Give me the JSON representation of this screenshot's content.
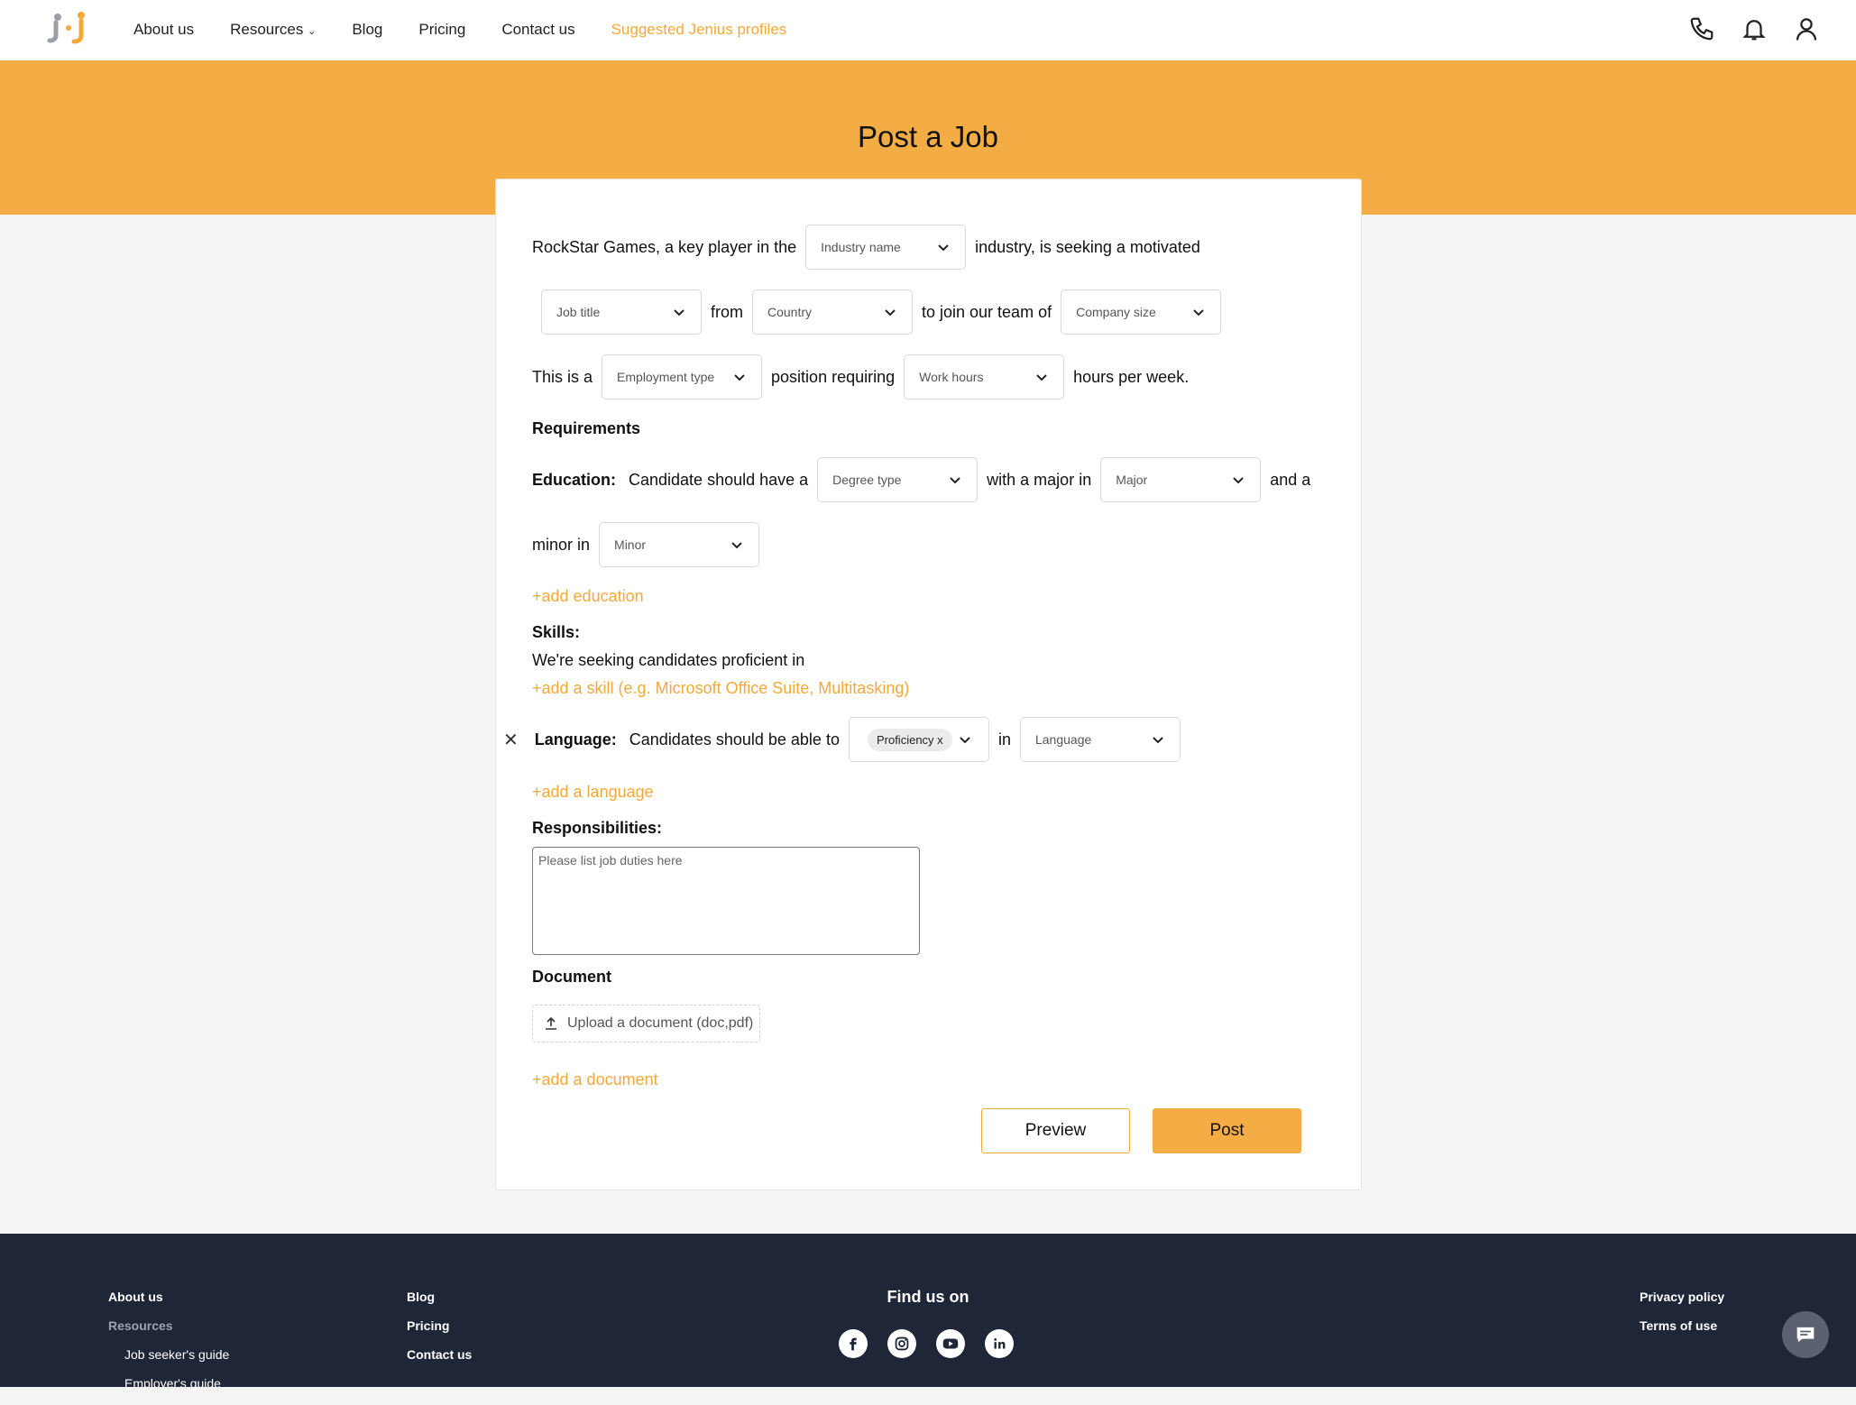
{
  "nav": {
    "links": [
      "About us",
      "Resources",
      "Blog",
      "Pricing",
      "Contact us",
      "Suggested Jenius profiles"
    ]
  },
  "page": {
    "title": "Post a Job"
  },
  "form": {
    "line1": {
      "prefix": "RockStar Games, a key player in the",
      "industry_placeholder": "Industry name",
      "suffix": "industry, is seeking a motivated"
    },
    "line2": {
      "job_placeholder": "Job title",
      "from": "from",
      "country_placeholder": "Country",
      "join": "to join our team of",
      "company_placeholder": "Company size"
    },
    "line3": {
      "prefix": "This is a",
      "employment_placeholder": "Employment type",
      "mid": "position requiring",
      "hours_placeholder": "Work hours",
      "suffix": "hours per week."
    },
    "requirements_label": "Requirements",
    "education": {
      "label": "Education:",
      "text": "Candidate should have a",
      "degree_placeholder": "Degree type",
      "with_major": "with a major in",
      "major_placeholder": "Major",
      "and_a": "and a",
      "minor_in": "minor in",
      "minor_placeholder": "Minor",
      "add": "+add education"
    },
    "skills": {
      "label": "Skills:",
      "text": "We're seeking candidates proficient in",
      "add": "+add a skill (e.g. Microsoft Office Suite, Multitasking)"
    },
    "language": {
      "label": "Language:",
      "text": "Candidates should be able to",
      "chip": "Proficiency",
      "chip_x": "x",
      "in": "in",
      "language_placeholder": "Language",
      "add": "+add a language"
    },
    "responsibilities": {
      "label": "Responsibilities:",
      "placeholder": "Please list job duties here"
    },
    "document": {
      "label": "Document",
      "upload": "Upload a document (doc,pdf)",
      "add": "+add a document"
    },
    "buttons": {
      "preview": "Preview",
      "post": "Post"
    }
  },
  "footer": {
    "col1": [
      "About us",
      "Resources",
      "Job seeker's guide",
      "Employer's guide"
    ],
    "col2": [
      "Blog",
      "Pricing",
      "Contact us"
    ],
    "find_us": "Find us on",
    "social": [
      "facebook-icon",
      "instagram-icon",
      "youtube-icon",
      "linkedin-icon"
    ],
    "col4": [
      "Privacy policy",
      "Terms of use"
    ]
  },
  "colors": {
    "accent": "#f4ad45",
    "footer_bg": "#1e2637"
  }
}
